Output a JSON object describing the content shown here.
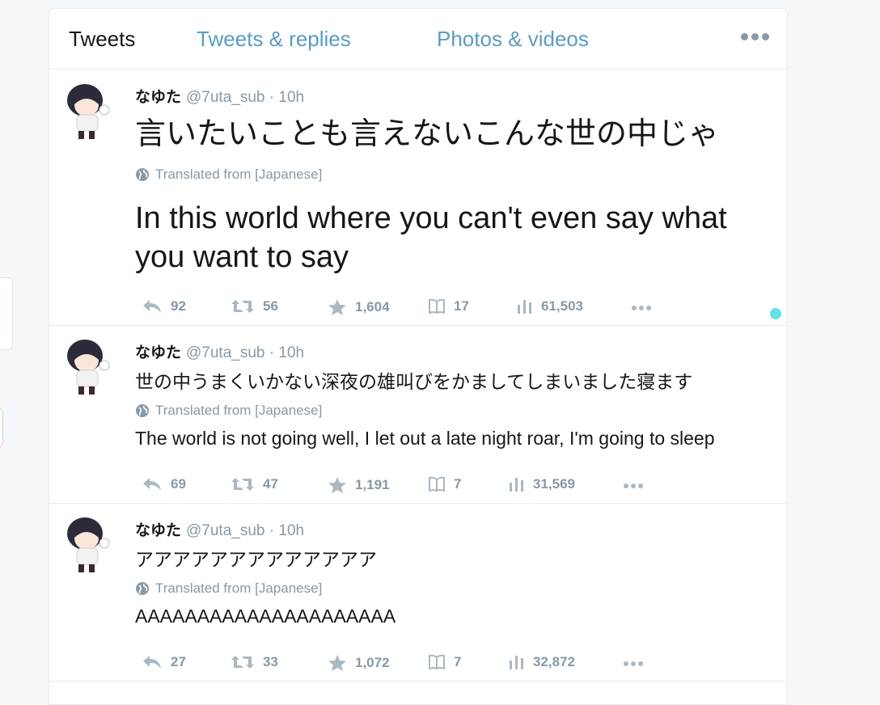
{
  "tabs": {
    "tweets": "Tweets",
    "replies": "Tweets & replies",
    "media": "Photos & videos",
    "more_icon": "more-dots-icon"
  },
  "tweets": [
    {
      "name": "なゆた",
      "handle": "@7uta_sub",
      "time": "· 10h",
      "text_jp": "言いたいことも言えないこんな世の中じゃ",
      "translated_label": "Translated from [Japanese]",
      "text_en": "In this world where you can't even say what you want to say",
      "replies": "92",
      "retweets": "56",
      "likes": "1,604",
      "bookmarks": "17",
      "views": "61,503"
    },
    {
      "name": "なゆた",
      "handle": "@7uta_sub",
      "time": "· 10h",
      "text_jp": "世の中うまくいかない深夜の雄叫びをかましてしまいました寝ます",
      "translated_label": "Translated from [Japanese]",
      "text_en": "The world is not going well, I let out a late night roar, I'm going to sleep",
      "replies": "69",
      "retweets": "47",
      "likes": "1,191",
      "bookmarks": "7",
      "views": "31,569"
    },
    {
      "name": "なゆた",
      "handle": "@7uta_sub",
      "time": "· 10h",
      "text_jp": "アアアアアアアアアアアアア",
      "translated_label": "Translated from [Japanese]",
      "text_en": "AAAAAAAAAAAAAAAAAAAAA",
      "replies": "27",
      "retweets": "33",
      "likes": "1,072",
      "bookmarks": "7",
      "views": "32,872"
    }
  ],
  "colors": {
    "link": "#5b9cc4",
    "muted": "#8899a6",
    "text": "#14171a",
    "accent_dot": "#67e0e6"
  }
}
